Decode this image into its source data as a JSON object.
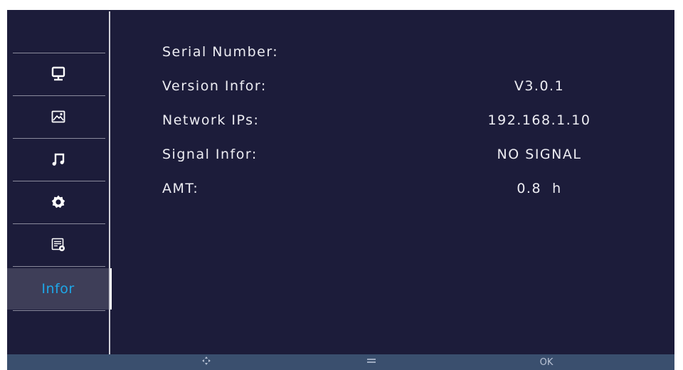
{
  "sidebar": {
    "items": [
      {
        "icon": "monitor-icon"
      },
      {
        "icon": "picture-icon"
      },
      {
        "icon": "music-note-icon"
      },
      {
        "icon": "gear-icon"
      },
      {
        "icon": "settings-document-icon"
      },
      {
        "label": "Infor",
        "active": true
      }
    ]
  },
  "info": {
    "rows": [
      {
        "label": "Serial Number:",
        "value": ""
      },
      {
        "label": "Version Infor:",
        "value": "V3.0.1"
      },
      {
        "label": "Network IPs:",
        "value": "192.168.1.10"
      },
      {
        "label": "Signal Infor:",
        "value": "NO SIGNAL"
      },
      {
        "label": "AMT:",
        "value": "0.8  h"
      }
    ]
  },
  "bottombar": {
    "navigate_icon": "arrows-icon",
    "menu_icon": "menu-lines-icon",
    "ok_label": "OK"
  },
  "colors": {
    "background": "#1c1c3a",
    "active_item": "#3e3e58",
    "accent_text": "#1ea7e8",
    "bottombar": "#3a4f6e"
  }
}
